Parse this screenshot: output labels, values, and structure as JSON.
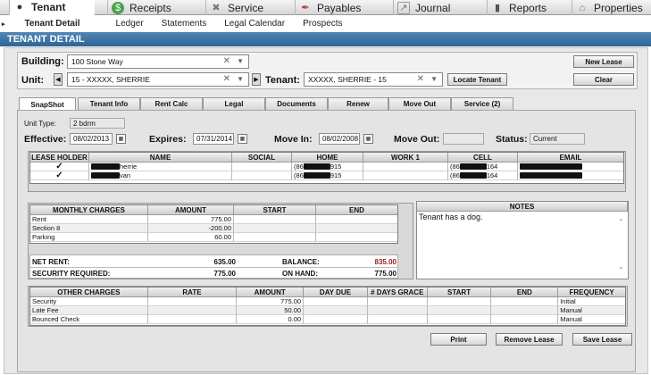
{
  "nav": {
    "tabs": [
      {
        "label": "Tenant",
        "icon": "person-icon"
      },
      {
        "label": "Receipts",
        "icon": "dollar-icon"
      },
      {
        "label": "Service",
        "icon": "tools-icon"
      },
      {
        "label": "Payables",
        "icon": "pen-icon"
      },
      {
        "label": "Journal",
        "icon": "chart-icon"
      },
      {
        "label": "Reports",
        "icon": "bar-chart-icon"
      },
      {
        "label": "Properties",
        "icon": "house-icon"
      }
    ],
    "sub": [
      "Tenant Detail",
      "Ledger",
      "Statements",
      "Legal Calendar",
      "Prospects"
    ]
  },
  "header": {
    "title": "TENANT DETAIL"
  },
  "form": {
    "building_label": "Building:",
    "building_value": "100 Stone Way",
    "unit_label": "Unit:",
    "unit_value": "15 - XXXXX, SHERRIE",
    "tenant_label": "Tenant:",
    "tenant_value": "XXXXX, SHERRIE - 15",
    "locate_btn": "Locate Tenant",
    "new_lease_btn": "New Lease",
    "clear_btn": "Clear"
  },
  "tabs": [
    "SnapShot",
    "Tenant Info",
    "Rent Calc",
    "Legal",
    "Documents",
    "Renew",
    "Move Out",
    "Service (2)"
  ],
  "snapshot": {
    "unit_type_label": "Unit Type:",
    "unit_type": "2 bdrm",
    "effective_label": "Effective:",
    "effective": "08/02/2013",
    "expires_label": "Expires:",
    "expires": "07/31/2014",
    "move_in_label": "Move In:",
    "move_in": "08/02/2008",
    "move_out_label": "Move Out:",
    "move_out": "",
    "status_label": "Status:",
    "status": "Current"
  },
  "contacts": {
    "headers": [
      "LEASE HOLDER",
      "NAME",
      "SOCIAL",
      "HOME",
      "WORK 1",
      "CELL",
      "EMAIL"
    ],
    "rows": [
      {
        "holder": "✓",
        "name": "herrie",
        "social": "",
        "home": "(86",
        "home_tail": "915",
        "work": "",
        "cell": "(86",
        "cell_tail": "164"
      },
      {
        "holder": "✓",
        "name": "van",
        "social": "",
        "home": "(86",
        "home_tail": "915",
        "work": "",
        "cell": "(86",
        "cell_tail": "164"
      }
    ]
  },
  "charges": {
    "headers": [
      "MONTHLY CHARGES",
      "AMOUNT",
      "START",
      "END"
    ],
    "rows": [
      {
        "name": "Rent",
        "amount": "775.00",
        "start": "",
        "end": ""
      },
      {
        "name": "Section 8",
        "amount": "-200.00",
        "start": "",
        "end": ""
      },
      {
        "name": "Parking",
        "amount": "60.00",
        "start": "",
        "end": ""
      }
    ],
    "net_rent_label": "NET RENT:",
    "net_rent": "635.00",
    "balance_label": "BALANCE:",
    "balance": "835.00",
    "security_label": "SECURITY REQUIRED:",
    "security": "775.00",
    "on_hand_label": "ON HAND:",
    "on_hand": "775.00"
  },
  "notes": {
    "header": "NOTES",
    "text": "Tenant has a dog."
  },
  "other_charges": {
    "headers": [
      "OTHER CHARGES",
      "RATE",
      "AMOUNT",
      "DAY DUE",
      "# DAYS GRACE",
      "START",
      "END",
      "FREQUENCY"
    ],
    "rows": [
      {
        "name": "Security",
        "rate": "",
        "amount": "775.00",
        "day_due": "",
        "grace": "",
        "start": "",
        "end": "",
        "freq": "Initial"
      },
      {
        "name": "Late Fee",
        "rate": "",
        "amount": "50.00",
        "day_due": "",
        "grace": "",
        "start": "",
        "end": "",
        "freq": "Manual"
      },
      {
        "name": "Bounced Check",
        "rate": "",
        "amount": "0.00",
        "day_due": "",
        "grace": "",
        "start": "",
        "end": "",
        "freq": "Manual"
      }
    ]
  },
  "actions": {
    "print": "Print",
    "remove": "Remove Lease",
    "save": "Save Lease"
  },
  "colors": {
    "accent": "#2e6496",
    "balance": "#9b1c1c"
  }
}
